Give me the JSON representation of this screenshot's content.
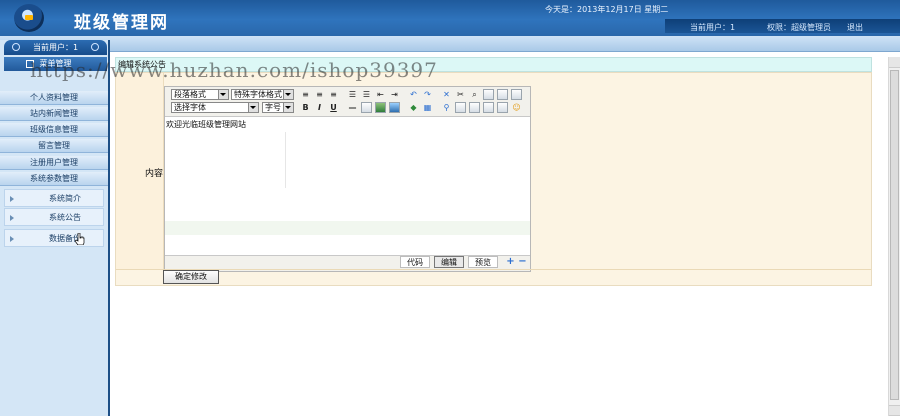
{
  "header": {
    "app_title": "班级管理网",
    "today": "今天是：2013年12月17日 星期二",
    "current_user": "当前用户：1",
    "role": "权限：超级管理员",
    "logout": "退出"
  },
  "sidebar": {
    "current_user": "当前用户：1",
    "menu_title": "菜单管理",
    "items": [
      {
        "label": "个人资料管理"
      },
      {
        "label": "站内新闻管理"
      },
      {
        "label": "班级信息管理"
      },
      {
        "label": "留言管理"
      },
      {
        "label": "注册用户管理"
      },
      {
        "label": "系统参数管理"
      }
    ],
    "sub_items": [
      {
        "label": "系统简介"
      },
      {
        "label": "系统公告"
      },
      {
        "label": "数据备份"
      }
    ]
  },
  "panel": {
    "title": "编辑系统公告",
    "field_label": "内容",
    "submit_label": "确定修改"
  },
  "editor": {
    "paragraph_format": "段落格式",
    "special_format": "特殊字体格式",
    "font_select": "选择字体",
    "font_size": "字号",
    "content": "欢迎光临班级管理网站",
    "modes": [
      "代码",
      "编辑",
      "预览"
    ],
    "active_mode": "编辑"
  },
  "watermark": "https://www.huzhan.com/ishop39397"
}
